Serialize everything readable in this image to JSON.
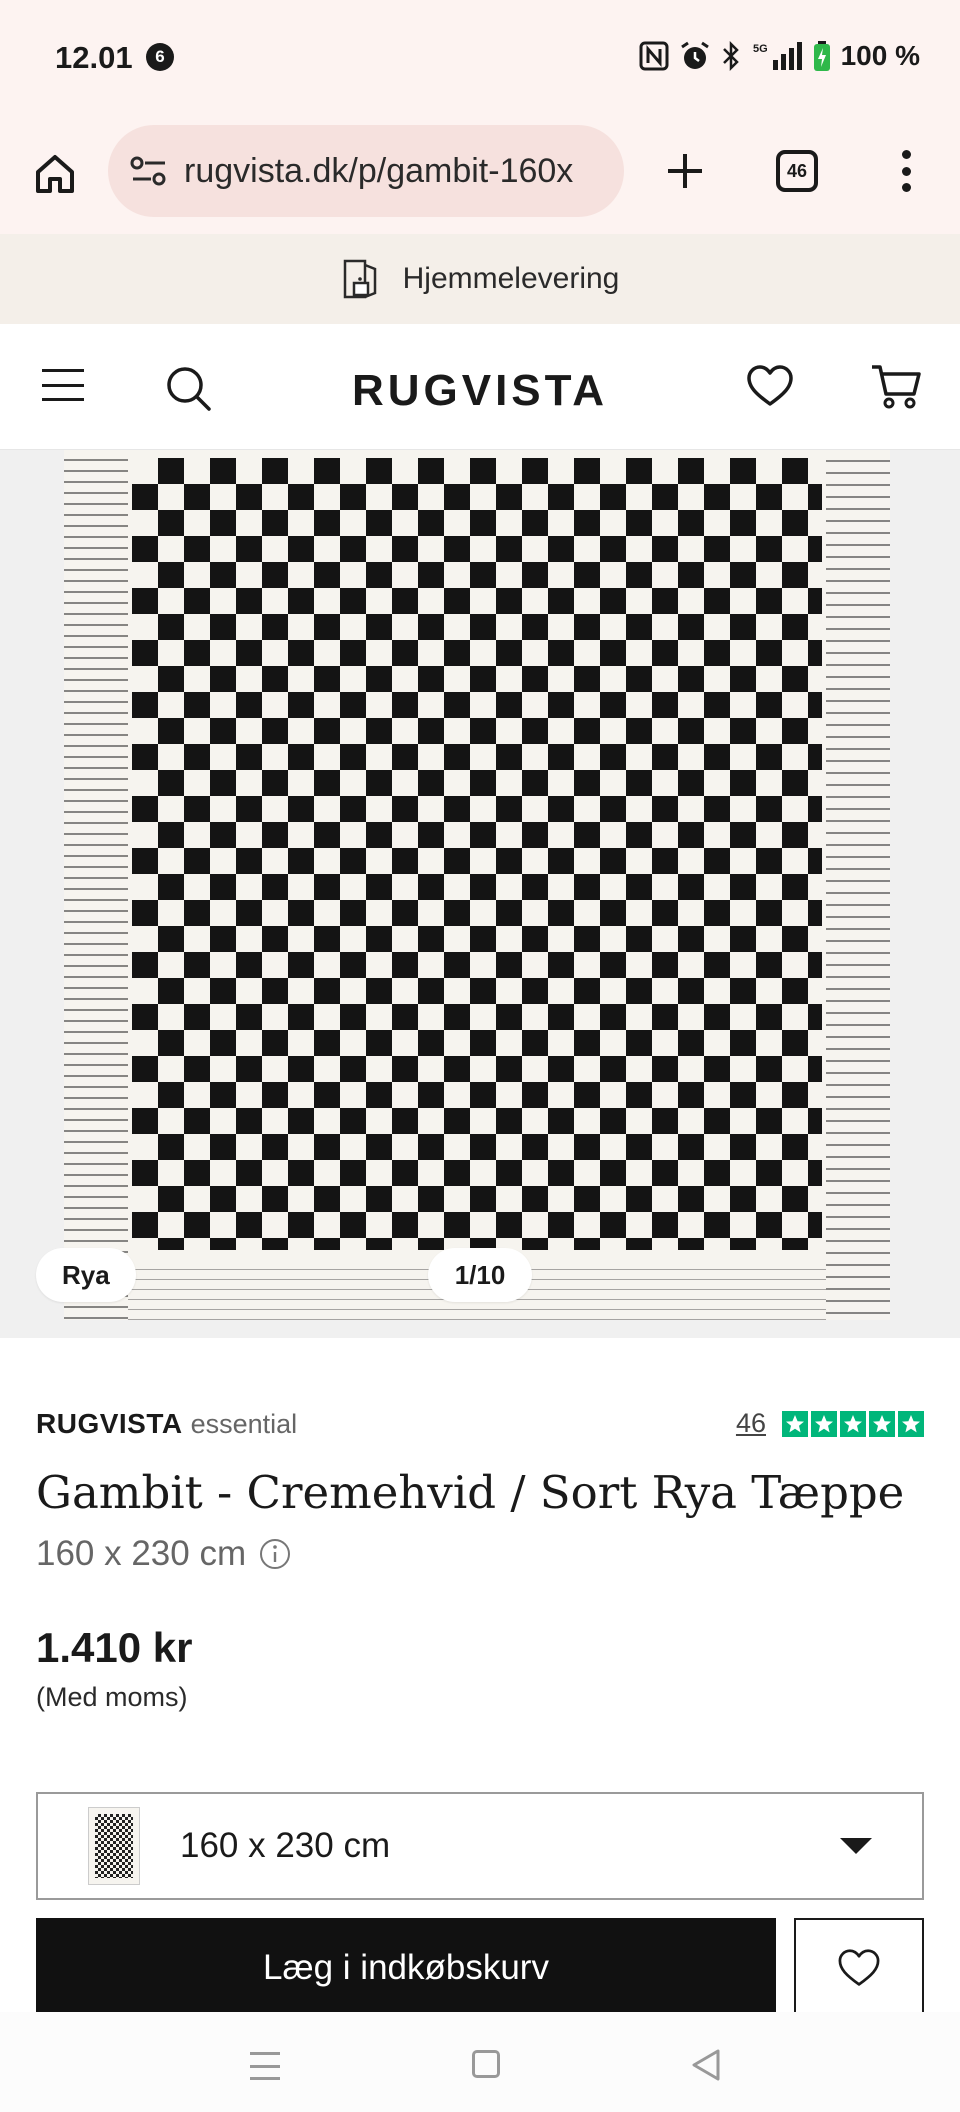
{
  "status_bar": {
    "time": "12.01",
    "notification_count": "6",
    "network": "5G",
    "battery": "100 %"
  },
  "browser": {
    "url": "rugvista.dk/p/gambit-160x",
    "tab_count": "46",
    "icons": [
      "home-icon",
      "site-settings-icon",
      "new-tab-plus-icon",
      "tab-switcher-icon",
      "overflow-menu-icon"
    ]
  },
  "banner": {
    "text": "Hjemmelevering",
    "icon": "home-delivery-door-icon"
  },
  "header": {
    "logo": "RUGVISTA",
    "icons": [
      "hamburger-menu-icon",
      "search-icon",
      "heart-icon",
      "cart-icon"
    ]
  },
  "gallery": {
    "type_badge": "Rya",
    "counter": "1/10"
  },
  "product": {
    "brand": "RUGVISTA",
    "brand_line": "essential",
    "review_count": "46",
    "star_rating": 5,
    "title": "Gambit - Cremehvid / Sort Rya Tæppe",
    "size": "160 x 230 cm",
    "price": "1.410 kr",
    "vat_note": "(Med moms)"
  },
  "purchase": {
    "selected_size": "160 x 230 cm",
    "add_to_cart_label": "Læg i indkøbskurv"
  },
  "colors": {
    "browser_chrome": "#fdf3f1",
    "url_pill": "#f6e1de",
    "banner_bg": "#f4efe9",
    "trustpilot_green": "#00b67a",
    "primary_button": "#111111"
  }
}
